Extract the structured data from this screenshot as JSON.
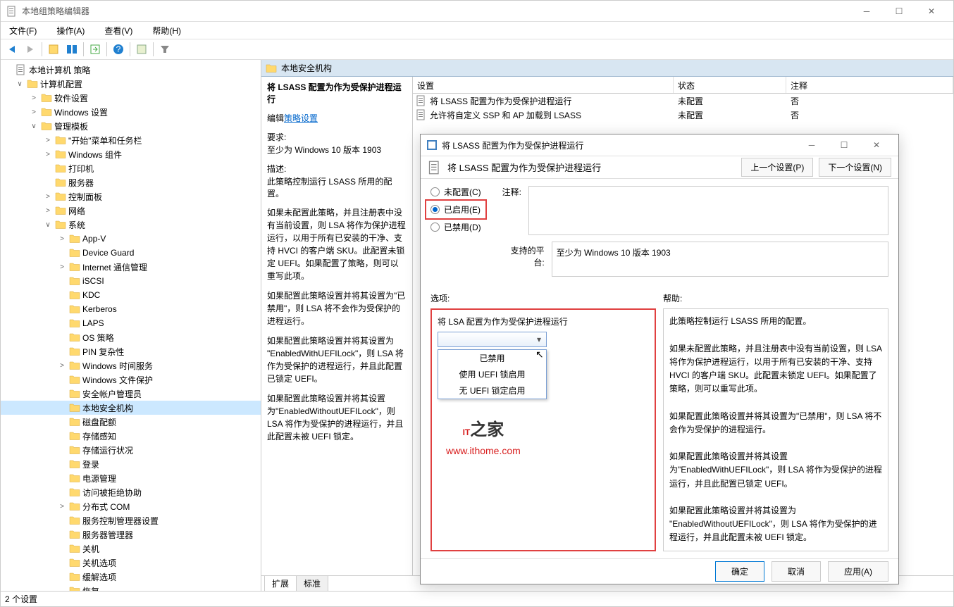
{
  "window": {
    "title": "本地组策略编辑器"
  },
  "menus": [
    "文件(F)",
    "操作(A)",
    "查看(V)",
    "帮助(H)"
  ],
  "tree": {
    "root": "本地计算机 策略",
    "items": [
      {
        "lvl": 0,
        "exp": "∨",
        "label": "计算机配置",
        "sel": false
      },
      {
        "lvl": 1,
        "exp": ">",
        "label": "软件设置"
      },
      {
        "lvl": 1,
        "exp": ">",
        "label": "Windows 设置"
      },
      {
        "lvl": 1,
        "exp": "∨",
        "label": "管理模板"
      },
      {
        "lvl": 2,
        "exp": ">",
        "label": "\"开始\"菜单和任务栏"
      },
      {
        "lvl": 2,
        "exp": ">",
        "label": "Windows 组件"
      },
      {
        "lvl": 2,
        "exp": "",
        "label": "打印机"
      },
      {
        "lvl": 2,
        "exp": "",
        "label": "服务器"
      },
      {
        "lvl": 2,
        "exp": ">",
        "label": "控制面板"
      },
      {
        "lvl": 2,
        "exp": ">",
        "label": "网络"
      },
      {
        "lvl": 2,
        "exp": "∨",
        "label": "系统"
      },
      {
        "lvl": 3,
        "exp": ">",
        "label": "App-V"
      },
      {
        "lvl": 3,
        "exp": "",
        "label": "Device Guard"
      },
      {
        "lvl": 3,
        "exp": ">",
        "label": "Internet 通信管理"
      },
      {
        "lvl": 3,
        "exp": "",
        "label": "iSCSI"
      },
      {
        "lvl": 3,
        "exp": "",
        "label": "KDC"
      },
      {
        "lvl": 3,
        "exp": "",
        "label": "Kerberos"
      },
      {
        "lvl": 3,
        "exp": "",
        "label": "LAPS"
      },
      {
        "lvl": 3,
        "exp": "",
        "label": "OS 策略"
      },
      {
        "lvl": 3,
        "exp": "",
        "label": "PIN 复杂性"
      },
      {
        "lvl": 3,
        "exp": ">",
        "label": "Windows 时间服务"
      },
      {
        "lvl": 3,
        "exp": "",
        "label": "Windows 文件保护"
      },
      {
        "lvl": 3,
        "exp": "",
        "label": "安全帐户管理员"
      },
      {
        "lvl": 3,
        "exp": "",
        "label": "本地安全机构",
        "sel": true
      },
      {
        "lvl": 3,
        "exp": "",
        "label": "磁盘配额"
      },
      {
        "lvl": 3,
        "exp": "",
        "label": "存储感知"
      },
      {
        "lvl": 3,
        "exp": "",
        "label": "存储运行状况"
      },
      {
        "lvl": 3,
        "exp": "",
        "label": "登录"
      },
      {
        "lvl": 3,
        "exp": "",
        "label": "电源管理"
      },
      {
        "lvl": 3,
        "exp": "",
        "label": "访问被拒绝协助"
      },
      {
        "lvl": 3,
        "exp": ">",
        "label": "分布式 COM"
      },
      {
        "lvl": 3,
        "exp": "",
        "label": "服务控制管理器设置"
      },
      {
        "lvl": 3,
        "exp": "",
        "label": "服务器管理器"
      },
      {
        "lvl": 3,
        "exp": "",
        "label": "关机"
      },
      {
        "lvl": 3,
        "exp": "",
        "label": "关机选项"
      },
      {
        "lvl": 3,
        "exp": "",
        "label": "缓解选项"
      },
      {
        "lvl": 3,
        "exp": "",
        "label": "恢复"
      }
    ]
  },
  "right": {
    "header": "本地安全机构",
    "desc_title": "将 LSASS 配置为作为受保护进程运行",
    "edit_label": "编辑",
    "policy_link": "策略设置",
    "req_label": "要求:",
    "req_value": "至少为 Windows 10 版本 1903",
    "desc_label": "描述:",
    "desc_p1": "此策略控制运行 LSASS 所用的配置。",
    "desc_p2": "如果未配置此策略，并且注册表中没有当前设置，则 LSA 将作为保护进程运行，以用于所有已安装的干净、支持 HVCI 的客户端 SKU。此配置未锁定 UEFI。如果配置了策略，则可以重写此项。",
    "desc_p3": "如果配置此策略设置并将其设置为\"已禁用\"，则 LSA 将不会作为受保护的进程运行。",
    "desc_p4": "如果配置此策略设置并将其设置为 \"EnabledWithUEFILock\"，则 LSA 将作为受保护的进程运行，并且此配置已锁定 UEFI。",
    "desc_p5": "如果配置此策略设置并将其设置为\"EnabledWithoutUEFILock\"，则 LSA 将作为受保护的进程运行，并且此配置未被 UEFI 锁定。",
    "columns": [
      "设置",
      "状态",
      "注释"
    ],
    "rows": [
      {
        "name": "将 LSASS 配置为作为受保护进程运行",
        "state": "未配置",
        "note": "否"
      },
      {
        "name": "允许将自定义 SSP 和 AP 加载到 LSASS",
        "state": "未配置",
        "note": "否"
      }
    ],
    "tabs": [
      "扩展",
      "标准"
    ]
  },
  "dialog": {
    "title": "将 LSASS 配置为作为受保护进程运行",
    "header_title": "将 LSASS 配置为作为受保护进程运行",
    "prev": "上一个设置(P)",
    "next": "下一个设置(N)",
    "radio_unconfigured": "未配置(C)",
    "radio_enabled": "已启用(E)",
    "radio_disabled": "已禁用(D)",
    "comment_label": "注释:",
    "platform_label": "支持的平台:",
    "platform_value": "至少为 Windows 10 版本 1903",
    "options_label": "选项:",
    "help_label": "帮助:",
    "option_title": "将 LSA 配置为作为受保护进程运行",
    "dropdown_items": [
      "已禁用",
      "使用 UEFI 锁启用",
      "无 UEFI 锁定启用"
    ],
    "help_p1": "此策略控制运行 LSASS 所用的配置。",
    "help_p2": "如果未配置此策略，并且注册表中没有当前设置，则 LSA 将作为保护进程运行，以用于所有已安装的干净、支持 HVCI 的客户端 SKU。此配置未锁定 UEFI。如果配置了策略，则可以重写此项。",
    "help_p3": "如果配置此策略设置并将其设置为\"已禁用\"，则 LSA 将不会作为受保护的进程运行。",
    "help_p4": "如果配置此策略设置并将其设置为\"EnabledWithUEFILock\"，则 LSA 将作为受保护的进程运行，并且此配置已锁定 UEFI。",
    "help_p5": "如果配置此策略设置并将其设置为 \"EnabledWithoutUEFILock\"，则 LSA 将作为受保护的进程运行，并且此配置未被 UEFI 锁定。",
    "watermark_url": "www.ithome.com",
    "watermark_it": "IT",
    "watermark_house": "之家",
    "btn_ok": "确定",
    "btn_cancel": "取消",
    "btn_apply": "应用(A)"
  },
  "status": "2 个设置"
}
